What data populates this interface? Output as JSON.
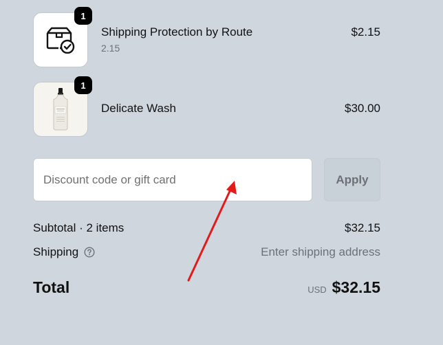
{
  "line_items": [
    {
      "name": "Shipping Protection by Route",
      "subtitle": "2.15",
      "price": "$2.15",
      "quantity": "1",
      "icon": "shipping-protection-icon"
    },
    {
      "name": "Delicate Wash",
      "price": "$30.00",
      "quantity": "1",
      "icon": "bottle-product-image"
    }
  ],
  "discount": {
    "placeholder": "Discount code or gift card",
    "value": "",
    "apply_label": "Apply"
  },
  "summary": {
    "subtotal_label": "Subtotal · 2 items",
    "subtotal_value": "$32.15",
    "shipping_label": "Shipping",
    "shipping_value": "Enter shipping address",
    "total_label": "Total",
    "currency": "USD",
    "total_value": "$32.15"
  },
  "colors": {
    "background": "#d0d6de",
    "annotation_arrow": "#e41a1a"
  }
}
